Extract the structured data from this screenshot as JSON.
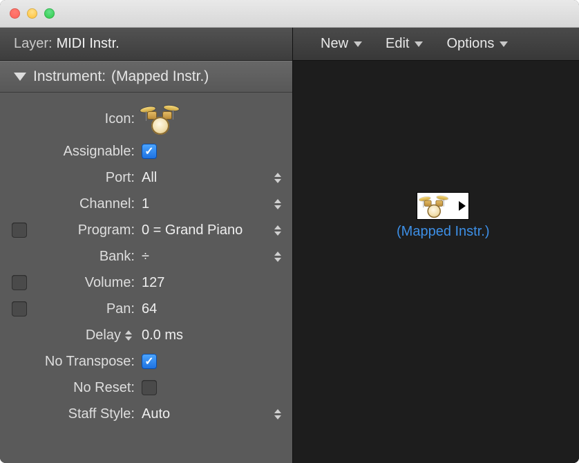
{
  "layer": {
    "label_prefix": "Layer:",
    "value": "MIDI Instr."
  },
  "instrument_header": {
    "label_prefix": "Instrument:",
    "name": "(Mapped Instr.)"
  },
  "inspector": {
    "icon_label": "Icon:",
    "icon_name": "drumkit-icon",
    "assignable": {
      "label": "Assignable:",
      "checked": true
    },
    "port": {
      "label": "Port:",
      "value": "All"
    },
    "channel": {
      "label": "Channel:",
      "value": "1"
    },
    "program": {
      "label": "Program:",
      "value": "0 = Grand Piano",
      "enabled": false
    },
    "bank": {
      "label": "Bank:",
      "value": "÷"
    },
    "volume": {
      "label": "Volume:",
      "value": "127",
      "enabled": false
    },
    "pan": {
      "label": "Pan:",
      "value": "64",
      "enabled": false
    },
    "delay": {
      "label": "Delay",
      "value": "0.0 ms"
    },
    "no_transpose": {
      "label": "No Transpose:",
      "checked": true
    },
    "no_reset": {
      "label": "No Reset:",
      "checked": false
    },
    "staff_style": {
      "label": "Staff Style:",
      "value": "Auto"
    }
  },
  "toolbar": {
    "new_label": "New",
    "edit_label": "Edit",
    "options_label": "Options"
  },
  "environment_object": {
    "label": "(Mapped Instr.)"
  }
}
